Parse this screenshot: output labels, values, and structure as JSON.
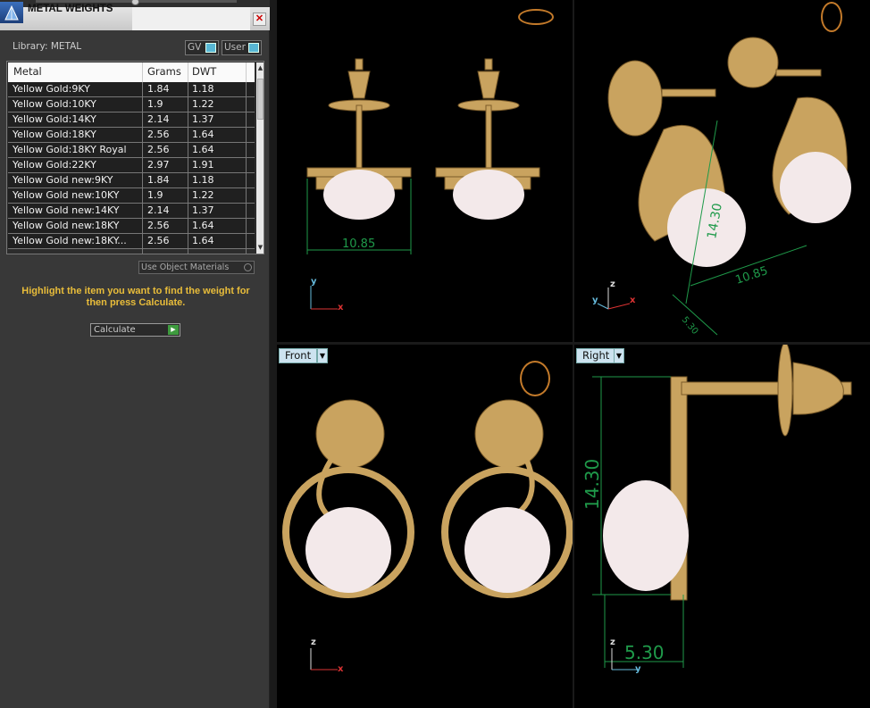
{
  "panel": {
    "title": "METAL WEIGHTS",
    "library_label": "Library: METAL",
    "toggle_gv": "GV",
    "toggle_user": "User",
    "columns": [
      "Metal",
      "Grams",
      "DWT"
    ],
    "rows": [
      [
        "Yellow Gold:9KY",
        "1.84",
        "1.18"
      ],
      [
        "Yellow Gold:10KY",
        "1.9",
        "1.22"
      ],
      [
        "Yellow Gold:14KY",
        "2.14",
        "1.37"
      ],
      [
        "Yellow Gold:18KY",
        "2.56",
        "1.64"
      ],
      [
        "Yellow Gold:18KY Royal",
        "2.56",
        "1.64"
      ],
      [
        "Yellow Gold:22KY",
        "2.97",
        "1.91"
      ],
      [
        "Yellow Gold new:9KY",
        "1.84",
        "1.18"
      ],
      [
        "Yellow Gold new:10KY",
        "1.9",
        "1.22"
      ],
      [
        "Yellow Gold new:14KY",
        "2.14",
        "1.37"
      ],
      [
        "Yellow Gold new:18KY",
        "2.56",
        "1.64"
      ],
      [
        "Yellow Gold new:18KY...",
        "2.56",
        "1.64"
      ]
    ],
    "use_object_materials": "Use Object Materials",
    "hint": "Highlight the item you want to find the weight for then press Calculate.",
    "calculate_label": "Calculate"
  },
  "viewports": {
    "top": {
      "axis_y": "y",
      "axis_x": "x",
      "dimension": "10.85"
    },
    "perspective": {
      "axis_z": "z",
      "axis_y": "y",
      "axis_x": "x",
      "dimension_a": "14.30",
      "dimension_b": "10.85",
      "dimension_c": "5.30"
    },
    "front": {
      "label": "Front",
      "axis_z": "z",
      "axis_x": "x"
    },
    "right": {
      "label": "Right",
      "axis_z": "z",
      "axis_y": "y",
      "dimension_a": "14.30",
      "dimension_b": "5.30"
    }
  },
  "colors": {
    "accent": "#58b7d4",
    "hint": "#e9bd3a",
    "dimension": "#1f9a4a",
    "gold": "#c9a35f"
  }
}
